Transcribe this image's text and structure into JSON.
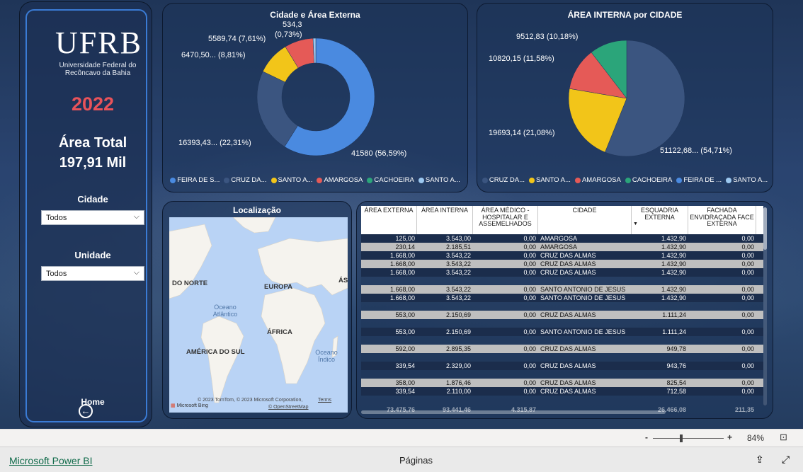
{
  "sidebar": {
    "logo_text": "UFRB",
    "logo_subtitle": "Universidade Federal do Recôncavo da Bahia",
    "year": "2022",
    "total_label": "Área Total",
    "total_value": "197,91 Mil",
    "filters": [
      {
        "label": "Cidade",
        "value": "Todos"
      },
      {
        "label": "Unidade",
        "value": "Todos"
      }
    ],
    "home_label": "Home"
  },
  "chart_data": [
    {
      "type": "pie",
      "variant": "donut",
      "title": "Cidade e Área Externa",
      "slices": [
        {
          "label": "FEIRA DE S...",
          "value": 41580,
          "display": "41580 (56,59%)",
          "color": "#4a8ae0"
        },
        {
          "label": "CRUZ DA...",
          "value": 16393.43,
          "display": "16393,43... (22,31%)",
          "color": "#3b5580"
        },
        {
          "label": "SANTO A...",
          "value": 6470.5,
          "display": "6470,50... (8,81%)",
          "color": "#f2c519"
        },
        {
          "label": "AMARGOSA",
          "value": 5589.74,
          "display": "5589,74 (7,61%)",
          "color": "#e55a57"
        },
        {
          "label": "CACHOEIRA",
          "value": 0,
          "display": "",
          "color": "#2ba57a"
        },
        {
          "label": "SANTO A...",
          "value": 534.3,
          "display": "534,3 (0,73%)",
          "color": "#9cc8f0"
        }
      ],
      "legend_position": "bottom"
    },
    {
      "type": "pie",
      "title": "ÁREA INTERNA por CIDADE",
      "slices": [
        {
          "label": "CRUZ DA...",
          "value": 51122.68,
          "display": "51122,68... (54,71%)",
          "color": "#3b5580"
        },
        {
          "label": "SANTO A...",
          "value": 19693.14,
          "display": "19693,14 (21,08%)",
          "color": "#f2c519"
        },
        {
          "label": "AMARGOSA",
          "value": 10820.15,
          "display": "10820,15 (11,58%)",
          "color": "#e55a57"
        },
        {
          "label": "CACHOEIRA",
          "value": 9512.83,
          "display": "9512,83 (10,18%)",
          "color": "#2ba57a"
        },
        {
          "label": "FEIRA DE ...",
          "value": 0,
          "display": "",
          "color": "#4a8ae0"
        },
        {
          "label": "SANTO A...",
          "value": 0,
          "display": "",
          "color": "#9cc8f0"
        }
      ],
      "legend_position": "bottom"
    }
  ],
  "chart1_labels": {
    "top": "534,3",
    "top2": "(0,73%)",
    "amargosa": "5589,74 (7,61%)",
    "santo": "6470,50...  (8,81%)",
    "cruz": "16393,43...  (22,31%)",
    "feira": "41580 (56,59%)"
  },
  "chart2_labels": {
    "cachoeira": "9512,83 (10,18%)",
    "amargosa": "10820,15 (11,58%)",
    "santo": "19693,14 (21,08%)",
    "cruz": "51122,68...  (54,71%)"
  },
  "legend1": [
    "FEIRA DE S...",
    "CRUZ DA...",
    "SANTO A...",
    "AMARGOSA",
    "CACHOEIRA",
    "SANTO A..."
  ],
  "legend2": [
    "CRUZ DA...",
    "SANTO A...",
    "AMARGOSA",
    "CACHOEIRA",
    "FEIRA DE ...",
    "SANTO A..."
  ],
  "map": {
    "title": "Localização",
    "labels": {
      "norte": "DO NORTE",
      "europa": "EUROPA",
      "asia": "ÁS",
      "africa": "ÁFRICA",
      "america_sul": "AMÉRICA DO SUL",
      "atlantico": "Oceano Atlântico",
      "indico": "Oceano Índico"
    },
    "copyright": "© 2023 TomTom, © 2023 Microsoft Corporation,",
    "terms": "Terms",
    "osm": "© OpenStreetMap",
    "bing": "Microsoft Bing"
  },
  "table": {
    "headers": [
      "ÁREA EXTERNA",
      "ÁREA INTERNA",
      "ÁREA MÉDICO - HOSPITALAR E ASSEMELHADOS",
      "CIDADE",
      "ESQUADRIA EXTERNA",
      "FACHADA ENVIDRAÇADA FACE EXTERNA"
    ],
    "rows": [
      {
        "style": "dark",
        "cells": [
          "125,00",
          "3.543,00",
          "0,00",
          "AMARGOSA",
          "1.432,90",
          "0,00"
        ]
      },
      {
        "style": "light",
        "cells": [
          "230,14",
          "2.185,51",
          "0,00",
          "AMARGOSA",
          "1.432,90",
          "0,00"
        ]
      },
      {
        "style": "dark",
        "cells": [
          "1.668,00",
          "3.543,22",
          "0,00",
          "CRUZ DAS ALMAS",
          "1.432,90",
          "0,00"
        ]
      },
      {
        "style": "light",
        "cells": [
          "1.668,00",
          "3.543,22",
          "0,00",
          "CRUZ DAS ALMAS",
          "1.432,90",
          "0,00"
        ]
      },
      {
        "style": "dark",
        "cells": [
          "1.668,00",
          "3.543,22",
          "0,00",
          "CRUZ DAS ALMAS",
          "1.432,90",
          "0,00"
        ]
      },
      {
        "style": "gap",
        "cells": [
          "",
          "",
          "",
          "",
          "",
          ""
        ]
      },
      {
        "style": "light",
        "cells": [
          "1.668,00",
          "3.543,22",
          "0,00",
          "SANTO ANTONIO DE JESUS",
          "1.432,90",
          "0,00"
        ]
      },
      {
        "style": "dark",
        "cells": [
          "1.668,00",
          "3.543,22",
          "0,00",
          "SANTO ANTONIO DE JESUS",
          "1.432,90",
          "0,00"
        ]
      },
      {
        "style": "gap",
        "cells": [
          "",
          "",
          "",
          "",
          "",
          ""
        ]
      },
      {
        "style": "light",
        "cells": [
          "553,00",
          "2.150,69",
          "0,00",
          "CRUZ DAS ALMAS",
          "1.111,24",
          "0,00"
        ]
      },
      {
        "style": "gap",
        "cells": [
          "",
          "",
          "",
          "",
          "",
          ""
        ]
      },
      {
        "style": "dark",
        "cells": [
          "553,00",
          "2.150,69",
          "0,00",
          "SANTO ANTONIO DE JESUS",
          "1.111,24",
          "0,00"
        ]
      },
      {
        "style": "gap",
        "cells": [
          "",
          "",
          "",
          "",
          "",
          ""
        ]
      },
      {
        "style": "light",
        "cells": [
          "592,00",
          "2.895,35",
          "0,00",
          "CRUZ DAS ALMAS",
          "949,78",
          "0,00"
        ]
      },
      {
        "style": "gap",
        "cells": [
          "",
          "",
          "",
          "",
          "",
          ""
        ]
      },
      {
        "style": "dark",
        "cells": [
          "339,54",
          "2.329,00",
          "0,00",
          "CRUZ DAS ALMAS",
          "943,76",
          "0,00"
        ]
      },
      {
        "style": "gap",
        "cells": [
          "",
          "",
          "",
          "",
          "",
          ""
        ]
      },
      {
        "style": "light",
        "cells": [
          "358,00",
          "1.876,46",
          "0,00",
          "CRUZ DAS ALMAS",
          "825,54",
          "0,00"
        ]
      },
      {
        "style": "dark",
        "cells": [
          "339,54",
          "2.110,00",
          "0,00",
          "CRUZ DAS ALMAS",
          "712,58",
          "0,00"
        ]
      }
    ],
    "totals": [
      "73.475,76",
      "93.441,46",
      "4.315,87",
      "",
      "26.466,08",
      "211,35"
    ]
  },
  "zoom": {
    "minus": "-",
    "plus": "+",
    "level": "84%"
  },
  "footer": {
    "brand": "Microsoft Power BI",
    "pages": "Páginas"
  },
  "colors": {
    "accent": "#3a7bd5",
    "year": "#e8535a",
    "background": "#2a4470"
  }
}
